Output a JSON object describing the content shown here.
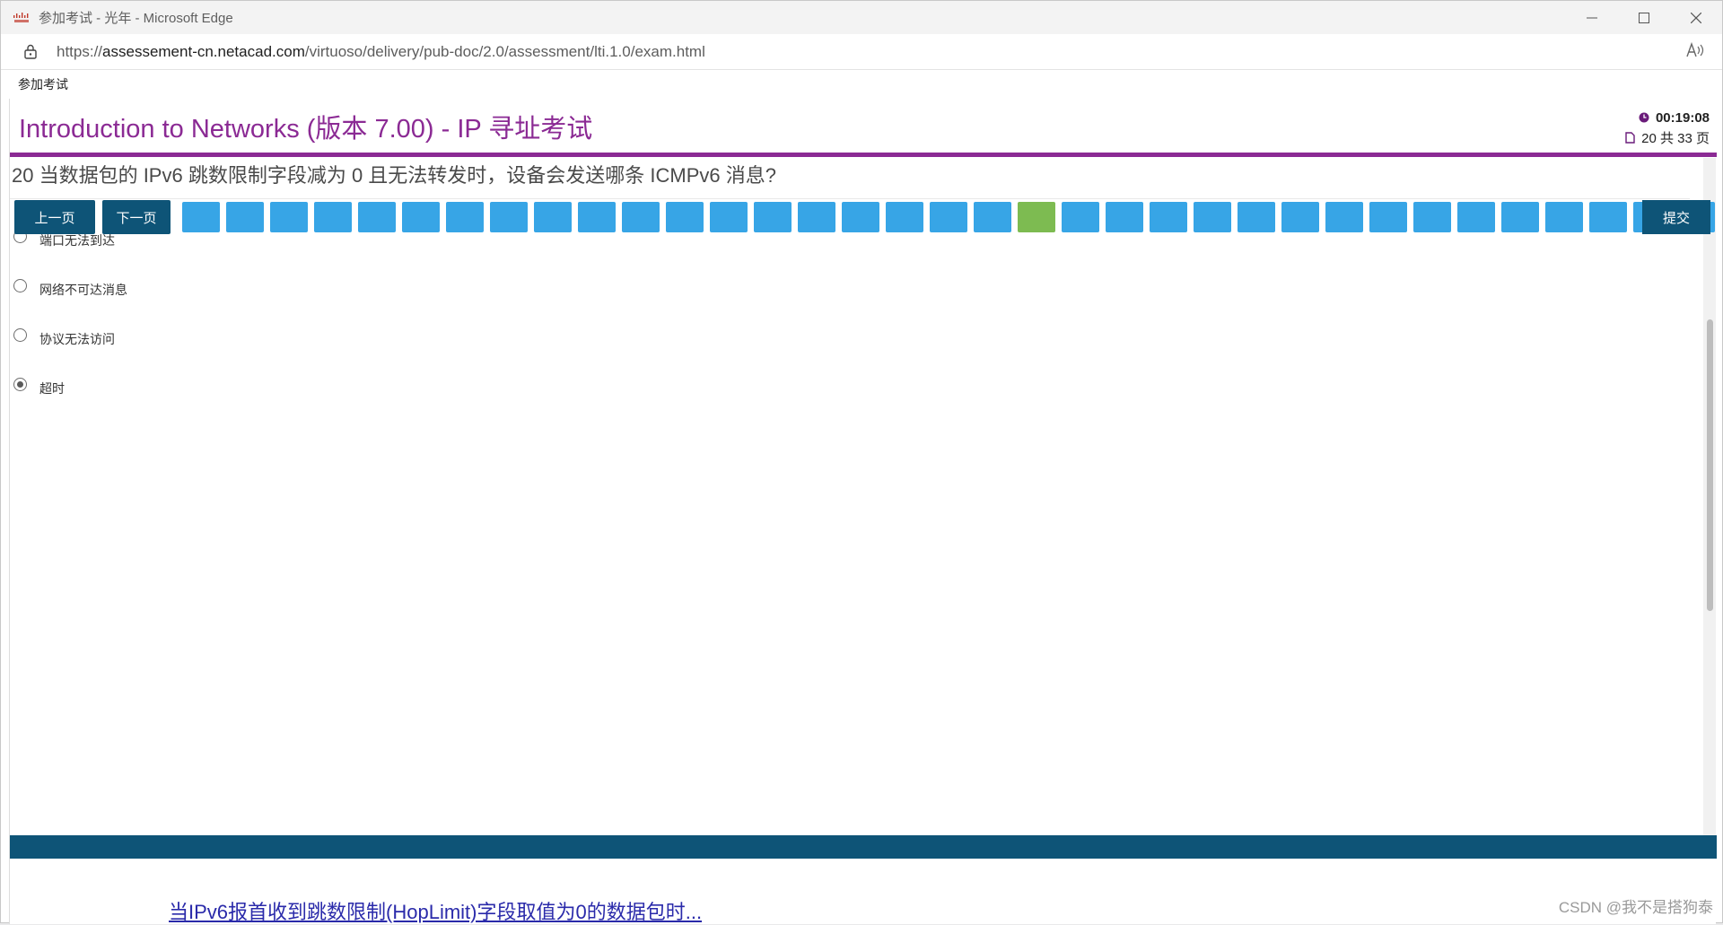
{
  "window": {
    "title": "参加考试 - 光年 - Microsoft Edge",
    "url_prefix": "https://",
    "url_host": "assessement-cn.netacad.com",
    "url_path": "/virtuoso/delivery/pub-doc/2.0/assessment/lti.1.0/exam.html",
    "bookmark": "参加考试"
  },
  "exam": {
    "title": "Introduction to Networks (版本 7.00) - IP 寻址考试",
    "timer": "00:19:08",
    "page_info": "20 共 33 页"
  },
  "question": {
    "text": "20  当数据包的 IPv6 跳数限制字段减为 0 且无法转发时，设备会发送哪条 ICMPv6 消息?",
    "options": [
      "端口无法到达",
      "网络不可达消息",
      "协议无法访问",
      "超时"
    ],
    "selected_index": 3
  },
  "nav": {
    "prev": "上一页",
    "next": "下一页",
    "submit": "提交",
    "question_count": 35,
    "current_index": 19
  },
  "background": {
    "link_fragment": "当IPv6报首收到跳数限制(HopLimit)字段取值为0的数据包时...",
    "watermark": "CSDN @我不是搭狗泰"
  },
  "colors": {
    "accent": "#8b2a94",
    "nav_bar": "#0e5477",
    "question_box": "#37a5e6",
    "current_box": "#7dbb51"
  }
}
